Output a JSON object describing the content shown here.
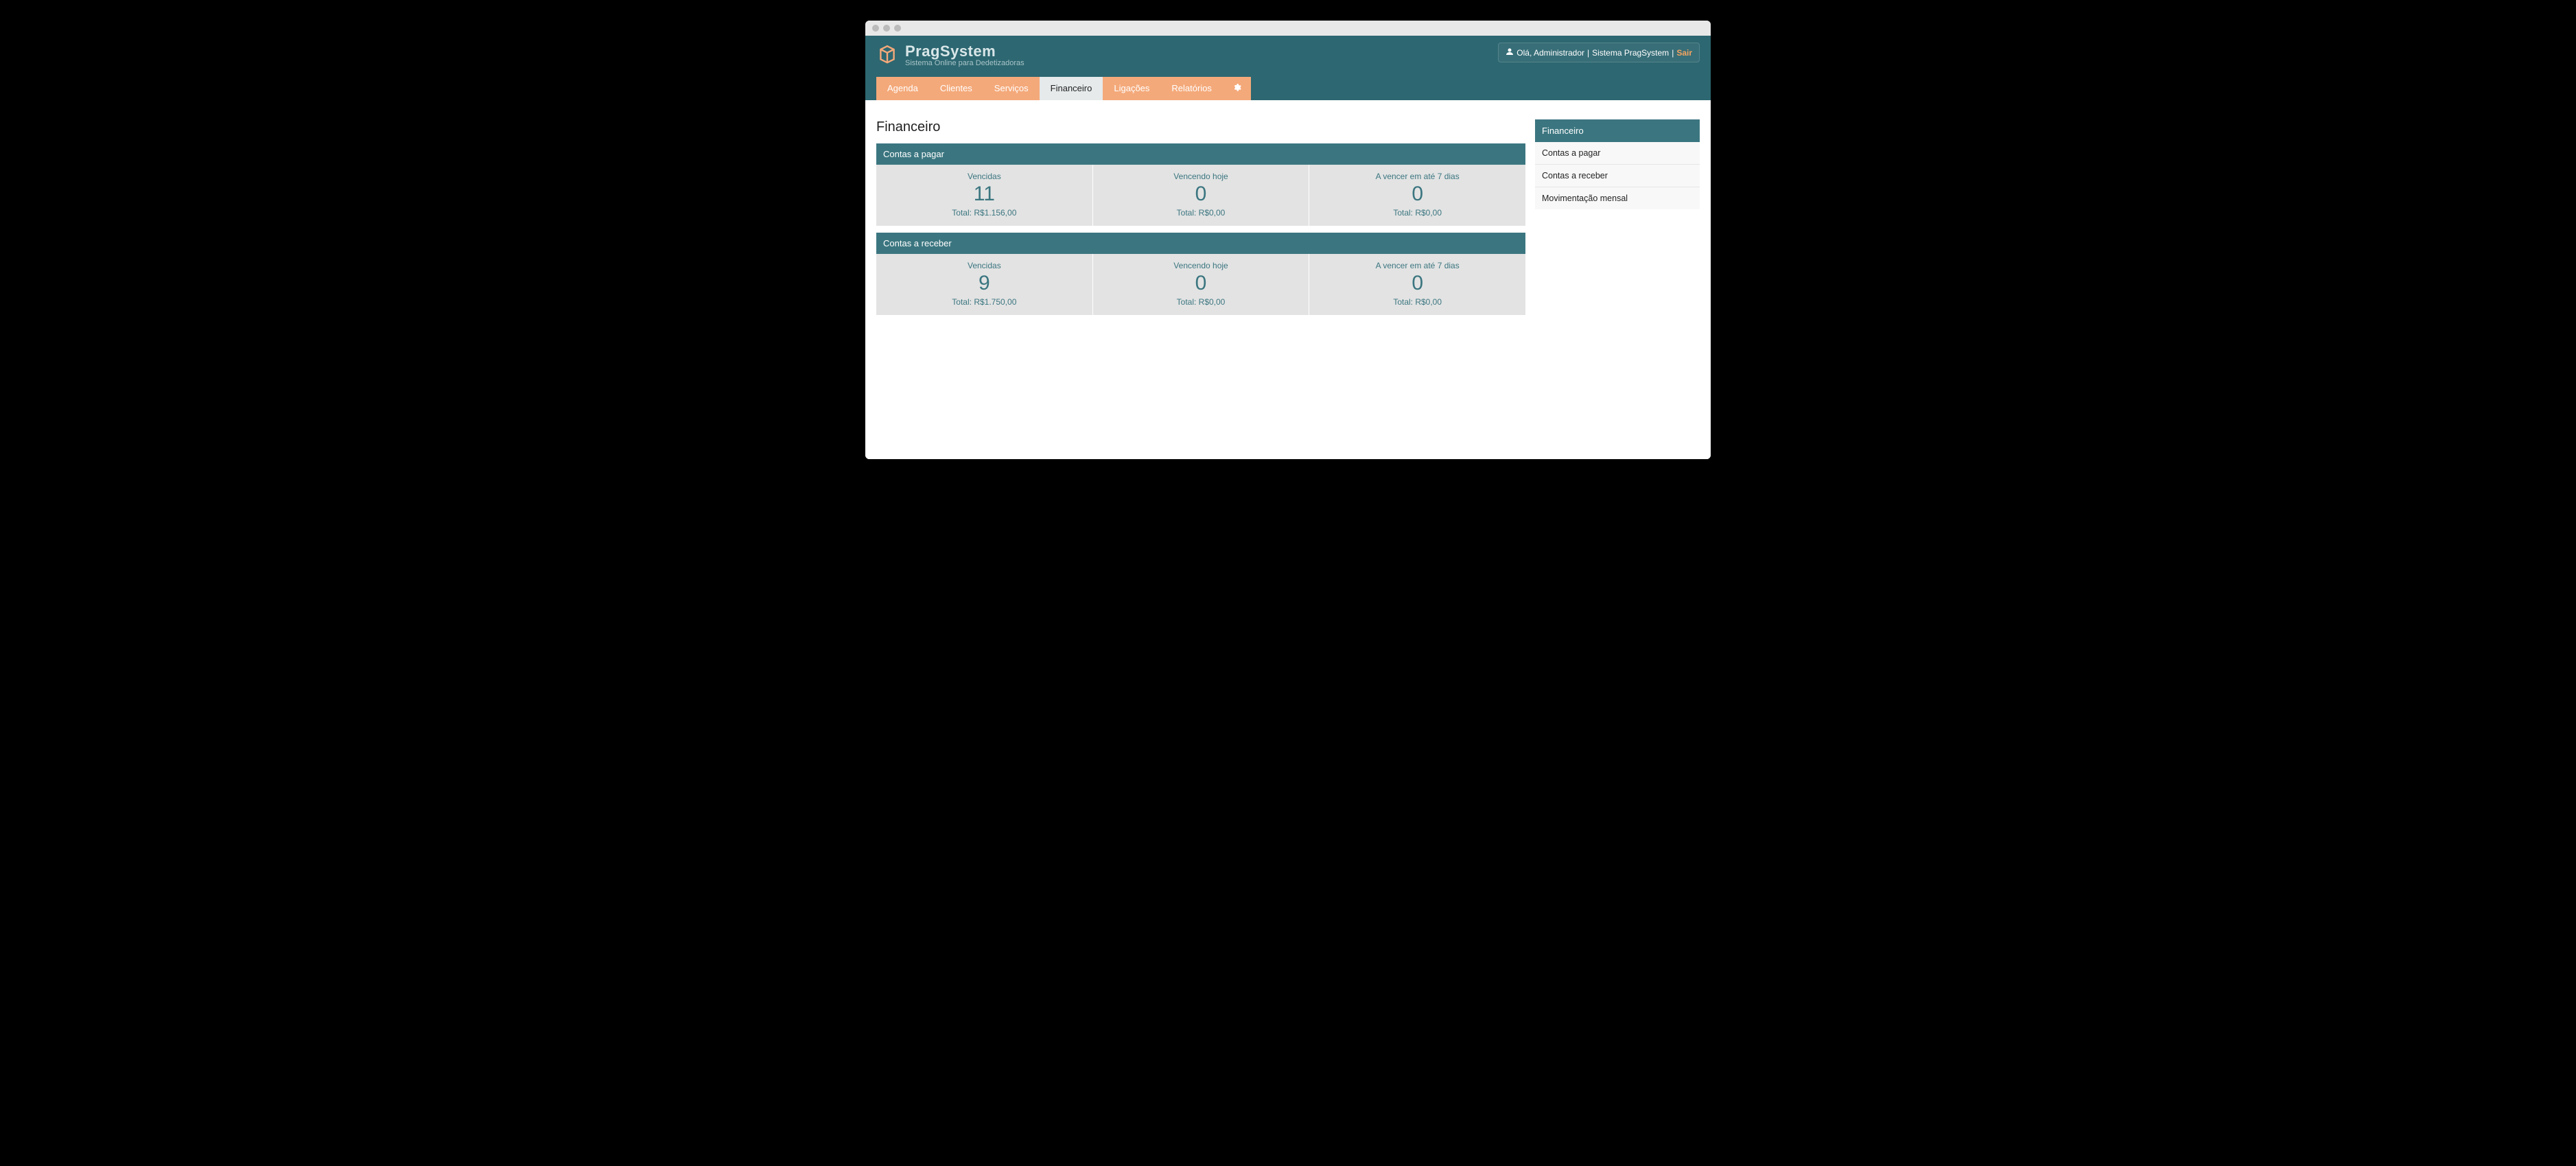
{
  "brand": {
    "name": "PragSystem",
    "tagline": "Sistema Online para Dedetizadoras"
  },
  "userbox": {
    "greeting": "Olá, Administrador",
    "system": "Sistema PragSystem",
    "logout": "Sair"
  },
  "nav": {
    "items": [
      {
        "label": "Agenda",
        "active": false
      },
      {
        "label": "Clientes",
        "active": false
      },
      {
        "label": "Serviços",
        "active": false
      },
      {
        "label": "Financeiro",
        "active": true
      },
      {
        "label": "Ligações",
        "active": false
      },
      {
        "label": "Relatórios",
        "active": false
      }
    ]
  },
  "page": {
    "title": "Financeiro"
  },
  "panels": [
    {
      "title": "Contas a pagar",
      "stats": [
        {
          "label": "Vencidas",
          "value": "11",
          "total": "Total: R$1.156,00"
        },
        {
          "label": "Vencendo hoje",
          "value": "0",
          "total": "Total: R$0,00"
        },
        {
          "label": "A vencer em até 7 dias",
          "value": "0",
          "total": "Total: R$0,00"
        }
      ]
    },
    {
      "title": "Contas a receber",
      "stats": [
        {
          "label": "Vencidas",
          "value": "9",
          "total": "Total: R$1.750,00"
        },
        {
          "label": "Vencendo hoje",
          "value": "0",
          "total": "Total: R$0,00"
        },
        {
          "label": "A vencer em até 7 dias",
          "value": "0",
          "total": "Total: R$0,00"
        }
      ]
    }
  ],
  "sidebar": {
    "title": "Financeiro",
    "items": [
      {
        "label": "Contas a pagar"
      },
      {
        "label": "Contas a receber"
      },
      {
        "label": "Movimentação mensal"
      }
    ]
  }
}
